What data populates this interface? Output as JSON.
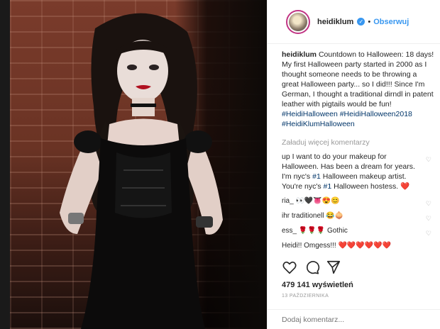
{
  "post": {
    "username": "heidiklum",
    "verified_glyph": "✓",
    "follow_label": "Obserwuj",
    "caption_user": "heidiklum",
    "caption_text": "Countdown to Halloween: 18 days! My first Halloween party started in 2000 as I thought someone needs to be throwing a great Halloween party... so I did!!! Since I'm German, I thought a traditional dirndl in patent leather with pigtails would be fun!",
    "hashtags": [
      "#HeidiHalloween",
      "#HeidiHalloween2018",
      "#HeidiKlumHalloween"
    ],
    "load_more": "Załaduj więcej komentarzy",
    "comments": [
      {
        "text": "up I want to do your makeup for Halloween. Has been a dream for years. I'm nyc's",
        "tag1": "#1",
        "mid": " Halloween makeup artist. You're nyc's ",
        "tag2": "#1",
        "end": " Halloween hostess. ❤️"
      },
      {
        "text": "ria_ 👀🖤👅😍😊"
      },
      {
        "text": "ihr traditionell 😂🧅"
      },
      {
        "text": "ess_ 🌹🌹🌹 Gothic"
      },
      {
        "text": "Heidi!! Omgess!!! ❤️❤️❤️❤️❤️❤️"
      }
    ],
    "likes": "479 141 wyświetleń",
    "date": "13 PAŹDZIERNIKA",
    "comment_placeholder": "Dodaj komentarz..."
  },
  "icons": {
    "heart": "heart-icon",
    "comment": "comment-icon",
    "share": "share-icon",
    "bookmark": "bookmark-icon",
    "small_heart": "small-heart-icon"
  },
  "colors": {
    "link": "#003569",
    "follow": "#3897f0",
    "muted": "#999999"
  }
}
